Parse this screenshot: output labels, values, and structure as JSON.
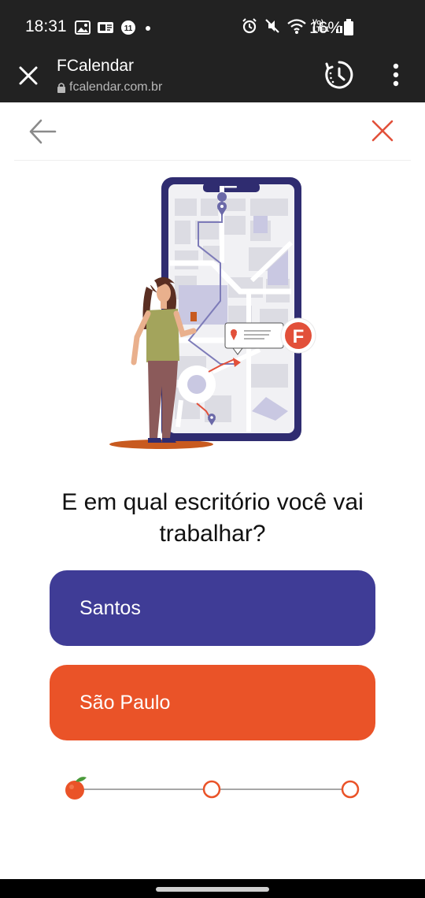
{
  "status_bar": {
    "time": "18:31",
    "battery": "16%",
    "network_label": "Vo) LTE1"
  },
  "browser": {
    "title": "FCalendar",
    "url": "fcalendar.com.br"
  },
  "page": {
    "question": "E em qual escritório você vai trabalhar?",
    "options": [
      {
        "label": "Santos",
        "color": "#3f3c96"
      },
      {
        "label": "São Paulo",
        "color": "#ea5328"
      }
    ],
    "progress": {
      "steps": 3,
      "current_step": 1
    }
  },
  "colors": {
    "accent_orange": "#ea5328",
    "accent_navy": "#3f3c96",
    "dark_bar": "#222222"
  },
  "icons": [
    "close-icon",
    "lock-icon",
    "timer-icon",
    "more-vert-icon",
    "back-arrow-icon",
    "close-red-icon",
    "orange-fruit-icon"
  ]
}
